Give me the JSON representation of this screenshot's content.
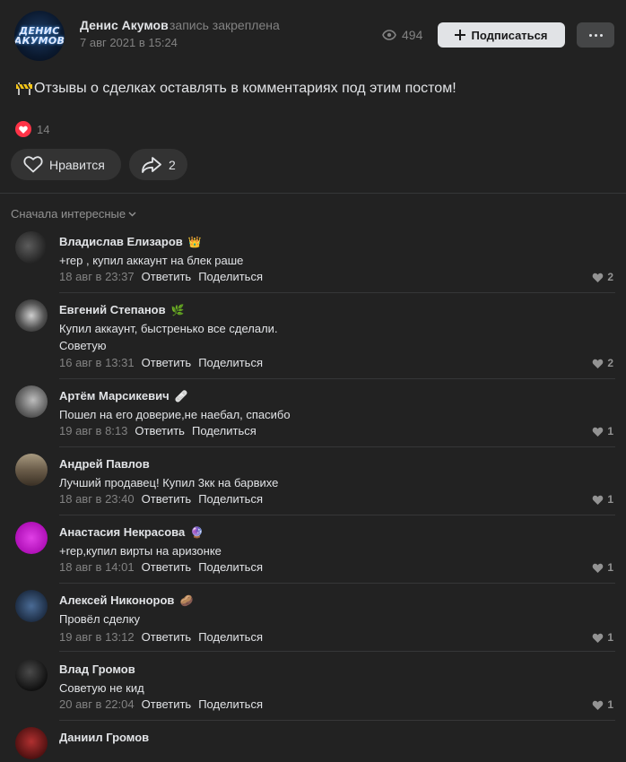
{
  "post": {
    "author": "Денис Акумов",
    "avatar_text_1": "ДЕНИС",
    "avatar_text_2": "АКУМОВ",
    "pinned": "запись закреплена",
    "date": "7 авг 2021 в 15:24",
    "views": "494",
    "subscribe_label": "Подписаться",
    "text": "Отзывы о сделках оставлять в комментариях под этим постом!",
    "likes_count": "14",
    "like_label": "Нравится",
    "shares_count": "2"
  },
  "comments_sort": "Сначала интересные",
  "comments": [
    {
      "name": "Владислав Елизаров",
      "emoji": "👑",
      "text": "+rep , купил аккаунт на блек раше",
      "time": "18 авг в 23:37",
      "reply": "Ответить",
      "share": "Поделиться",
      "likes": "2",
      "avatar_color": "#3a3a3a"
    },
    {
      "name": "Евгений Степанов",
      "emoji": "🌿",
      "text": "Купил аккаунт, быстренько все сделали.\nСоветую",
      "time": "16 авг в 13:31",
      "reply": "Ответить",
      "share": "Поделиться",
      "likes": "2",
      "avatar_color": "#5a5a5a"
    },
    {
      "name": "Артём Марсикевич",
      "emoji": "🩹",
      "text": "Пошел на его доверие,не наебал, спасибо",
      "time": "19 авг в 8:13",
      "reply": "Ответить",
      "share": "Поделиться",
      "likes": "1",
      "avatar_color": "#6a6a6a"
    },
    {
      "name": "Андрей Павлов",
      "emoji": "",
      "text": "Лучший продавец! Купил 3кк на барвихе",
      "time": "18 авг в 23:40",
      "reply": "Ответить",
      "share": "Поделиться",
      "likes": "1",
      "avatar_color": "#6b5d4a"
    },
    {
      "name": "Анастасия Некрасова",
      "emoji": "🔮",
      "text": "+rep,купил вирты на аризонке",
      "time": "18 авг в 14:01",
      "reply": "Ответить",
      "share": "Поделиться",
      "likes": "1",
      "avatar_color": "#c21fc9"
    },
    {
      "name": "Алексей Никоноров",
      "emoji": "🥔",
      "text": "Провёл сделку",
      "time": "19 авг в 13:12",
      "reply": "Ответить",
      "share": "Поделиться",
      "likes": "1",
      "avatar_color": "#2d3b52"
    },
    {
      "name": "Влад Громов",
      "emoji": "",
      "text": "Советую не кид",
      "time": "20 авг в 22:04",
      "reply": "Ответить",
      "share": "Поделиться",
      "likes": "1",
      "avatar_color": "#1c1c1c"
    },
    {
      "name": "Даниил Громов",
      "emoji": "",
      "text": "",
      "time": "",
      "reply": "",
      "share": "",
      "likes": "",
      "avatar_color": "#7a1a1a"
    }
  ]
}
